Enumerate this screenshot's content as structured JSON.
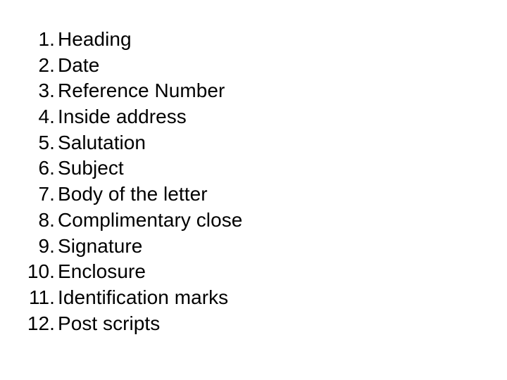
{
  "slide": {
    "background_color": "#ffffff",
    "text_color": "#000000",
    "list": {
      "items": [
        {
          "marker": "1.",
          "label": "Heading"
        },
        {
          "marker": "2.",
          "label": "Date"
        },
        {
          "marker": "3.",
          "label": "Reference Number"
        },
        {
          "marker": "4.",
          "label": "Inside address"
        },
        {
          "marker": "5.",
          "label": "Salutation"
        },
        {
          "marker": "6.",
          "label": "Subject"
        },
        {
          "marker": "7.",
          "label": "Body of the letter"
        },
        {
          "marker": "8.",
          "label": "Complimentary close"
        },
        {
          "marker": "9.",
          "label": "Signature"
        },
        {
          "marker": "10.",
          "label": "Enclosure"
        },
        {
          "marker": "11.",
          "label": "Identification marks"
        },
        {
          "marker": "12.",
          "label": "Post scripts"
        }
      ]
    }
  }
}
